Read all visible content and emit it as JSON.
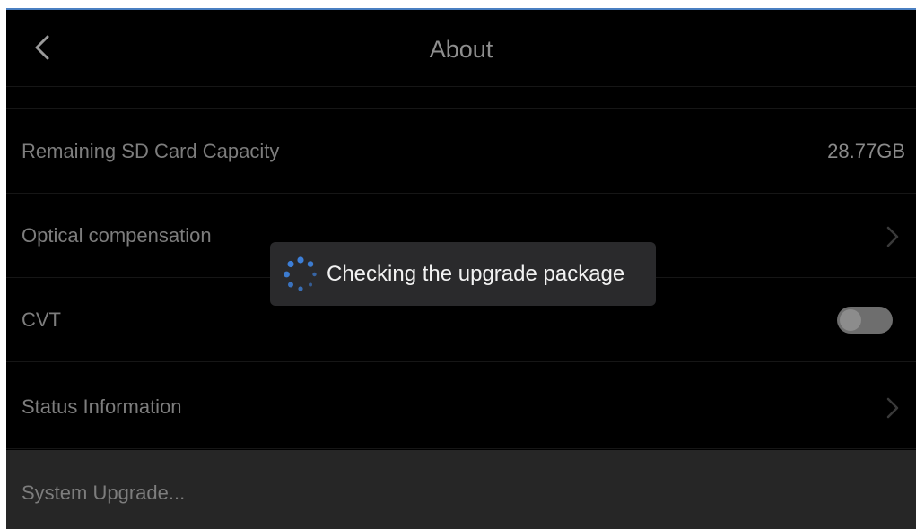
{
  "header": {
    "title": "About",
    "back_icon": "chevron-left-icon"
  },
  "rows": [
    {
      "label": "Remaining SD Card Capacity",
      "value": "28.77GB"
    },
    {
      "label": "Optical compensation",
      "icon": "chevron-right-icon"
    },
    {
      "label": "CVT",
      "toggle": false
    },
    {
      "label": "Status Information",
      "icon": "chevron-right-icon"
    }
  ],
  "upgrade": {
    "label": "System Upgrade..."
  },
  "toast": {
    "text": "Checking the upgrade package",
    "icon": "loading-spinner-icon"
  },
  "colors": {
    "accent": "#4a7fc1",
    "spinner": "#3d7fd8",
    "background": "#000000",
    "toast_background": "#2a2a2c"
  }
}
